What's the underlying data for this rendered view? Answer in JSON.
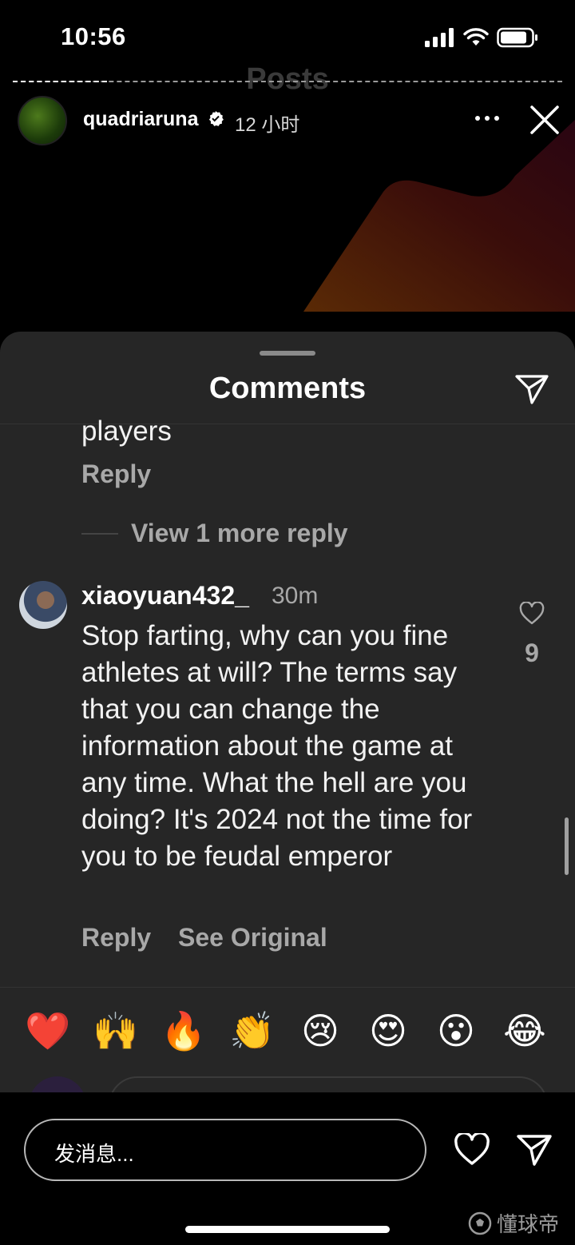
{
  "status_bar": {
    "time": "10:56"
  },
  "story": {
    "title": "Posts",
    "username": "quadriaruna",
    "time": "12 小时"
  },
  "comments_sheet": {
    "title": "Comments",
    "previous_comment": {
      "text_tail": "players",
      "reply_label": "Reply",
      "view_more_label": "View 1 more reply"
    },
    "comment": {
      "username": "xiaoyuan432_",
      "time": "30m",
      "text": "Stop farting, why can you fine athletes at will? The terms say that you can change the information about the game at any time. What the hell are you doing? It's 2024 not the time for you to be feudal emperor",
      "reply_label": "Reply",
      "see_original_label": "See Original",
      "like_count": "9"
    },
    "emojis": [
      "❤️",
      "🙌",
      "🔥",
      "👏",
      "😢",
      "😍",
      "😮",
      "😂"
    ]
  },
  "bottom_bar": {
    "message_placeholder": "发消息..."
  },
  "watermark": {
    "text": "懂球帝"
  }
}
